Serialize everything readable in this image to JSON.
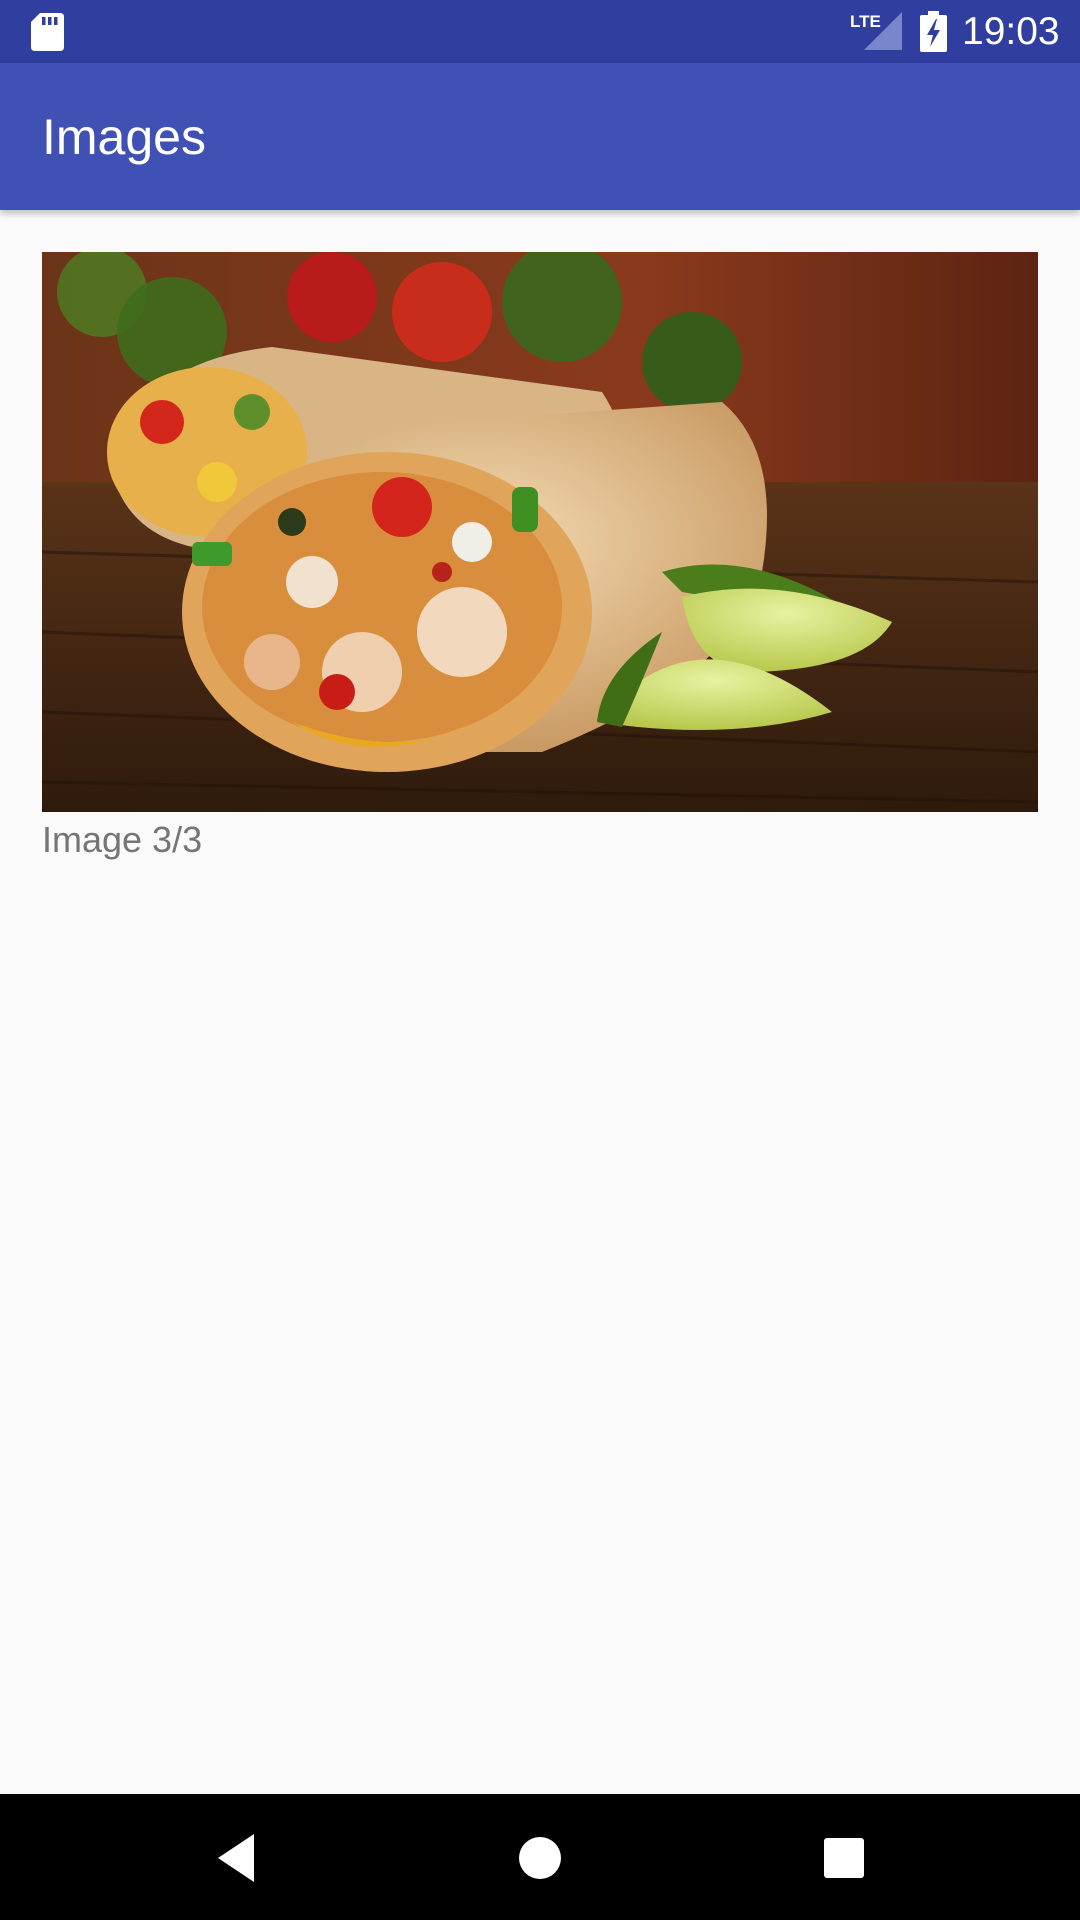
{
  "status_bar": {
    "time": "19:03",
    "network_label": "LTE",
    "icons": [
      "sd-card-icon",
      "lte-signal-icon",
      "battery-charging-icon"
    ]
  },
  "app_bar": {
    "title": "Images"
  },
  "gallery": {
    "image_alt": "burrito-photo",
    "caption": "Image 3/3"
  },
  "nav_bar": {
    "icons": [
      "back-icon",
      "home-icon",
      "recents-icon"
    ]
  },
  "colors": {
    "status_bar": "#303f9f",
    "app_bar": "#3f51b5",
    "background": "#fafafa",
    "caption_text": "#757575"
  }
}
